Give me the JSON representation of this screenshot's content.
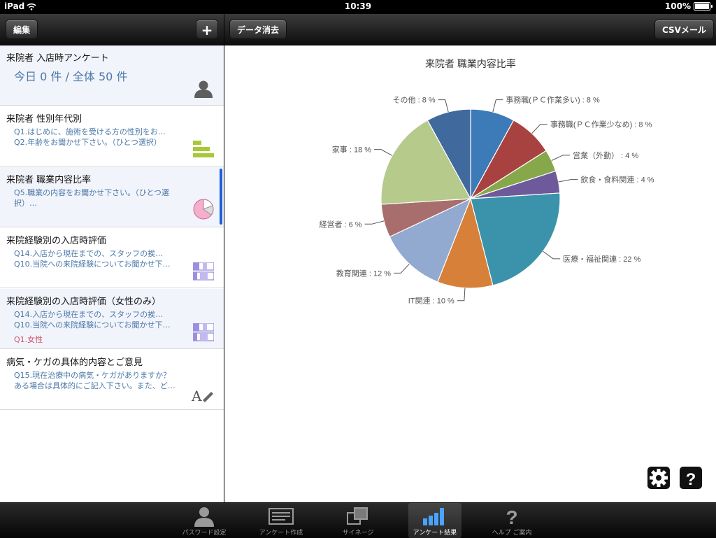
{
  "status": {
    "device": "iPad",
    "time": "10:39",
    "battery": "100%"
  },
  "nav_left": {
    "edit": "編集",
    "add": "+"
  },
  "nav_right": {
    "clear": "データ消去",
    "csv": "CSVメール"
  },
  "surveys": [
    {
      "title": "来院者 入店時アンケート",
      "summary": "今日 0 件 / 全体 50 件"
    },
    {
      "title": "来院者 性別年代別",
      "lines": [
        "Q1.はじめに、施術を受ける方の性別をお…",
        "Q2.年齢をお聞かせ下さい。（ひとつ選択）"
      ]
    },
    {
      "title": "来院者 職業内容比率",
      "lines": [
        "Q5.職業の内容をお聞かせ下さい。（ひとつ選",
        "択）…"
      ]
    },
    {
      "title": "来院経験別の入店時評価",
      "lines": [
        "Q14.入店から現在までの、スタッフの挨…",
        "Q10.当院への来院経験についてお聞かせ下…"
      ]
    },
    {
      "title": "来院経験別の入店時評価（女性のみ）",
      "lines": [
        "Q14.入店から現在までの、スタッフの挨…",
        "Q10.当院への来院経験についてお聞かせ下…"
      ],
      "filter": "Q1.女性"
    },
    {
      "title": "病気・ケガの具体的内容とご意見",
      "lines": [
        "Q15.現在治療中の病気・ケガがありますか？",
        "ある場合は具体的にご記入下さい。また、ど…"
      ]
    }
  ],
  "chart_data": {
    "type": "pie",
    "title": "来院者 職業内容比率",
    "unit": "%",
    "slices": [
      {
        "label": "事務職(ＰＣ作業多い)",
        "value": 8,
        "display": "事務職(ＰＣ作業多い) : 8 %",
        "color": "#3d7ab8"
      },
      {
        "label": "事務職(ＰＣ作業少なめ)",
        "value": 8,
        "display": "事務職(ＰＣ作業少なめ) : 8 %",
        "color": "#a84240"
      },
      {
        "label": "営業（外勤）",
        "value": 4,
        "display": "営業（外勤） : 4 %",
        "color": "#86a84a"
      },
      {
        "label": "飲食・食料関連",
        "value": 4,
        "display": "飲食・食料関連 : 4 %",
        "color": "#6e5a9a"
      },
      {
        "label": "医療・福祉関連",
        "value": 22,
        "display": "医療・福祉関連 : 22 %",
        "color": "#3a93aa"
      },
      {
        "label": "IT関連",
        "value": 10,
        "display": "IT関連 : 10 %",
        "color": "#d6803a"
      },
      {
        "label": "教育関連",
        "value": 12,
        "display": "教育関連 : 12 %",
        "color": "#92a9d0"
      },
      {
        "label": "経営者",
        "value": 6,
        "display": "経営者 : 6 %",
        "color": "#a86e6e"
      },
      {
        "label": "家事",
        "value": 18,
        "display": "家事 : 18 %",
        "color": "#b6ca8c"
      },
      {
        "label": "その他",
        "value": 8,
        "display": "その他 : 8 %",
        "color": "#40699e"
      }
    ]
  },
  "tabs": [
    {
      "label": "パスワード設定",
      "icon": "person-icon"
    },
    {
      "label": "アンケート作成",
      "icon": "form-icon"
    },
    {
      "label": "サイネージ",
      "icon": "signage-icon"
    },
    {
      "label": "アンケート結果",
      "icon": "bar-chart-icon",
      "active": true
    },
    {
      "label": "ヘルプ ご案内",
      "icon": "question-icon"
    }
  ],
  "colors": {
    "accent": "#1c5fd6",
    "link": "#4a78a8",
    "filter": "#d0506a",
    "tab_active": "#4aa3ff"
  }
}
